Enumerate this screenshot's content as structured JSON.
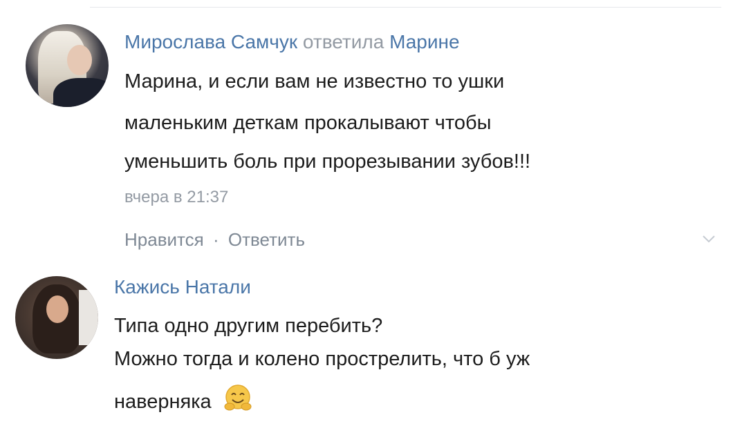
{
  "comments": [
    {
      "author": "Мирослава Самчук",
      "reply_word": "ответила",
      "reply_to": "Марине",
      "lines": [
        "Марина, и если вам не известно то ушки",
        "маленьким деткам прокалывают чтобы",
        "уменьшить боль при прорезывании зубов!!!"
      ],
      "timestamp": "вчера в 21:37",
      "like_label": "Нравится",
      "separator": "·",
      "reply_label": "Ответить"
    },
    {
      "author": "Кажись Натали",
      "lines": [
        "Типа одно другим перебить?",
        "Можно тогда и колено прострелить, что б уж",
        "наверняка"
      ],
      "emoji": "hugging-face-emoji"
    }
  ],
  "colors": {
    "link": "#4a76a8",
    "muted": "#939aa3",
    "text": "#1c1c1c"
  }
}
